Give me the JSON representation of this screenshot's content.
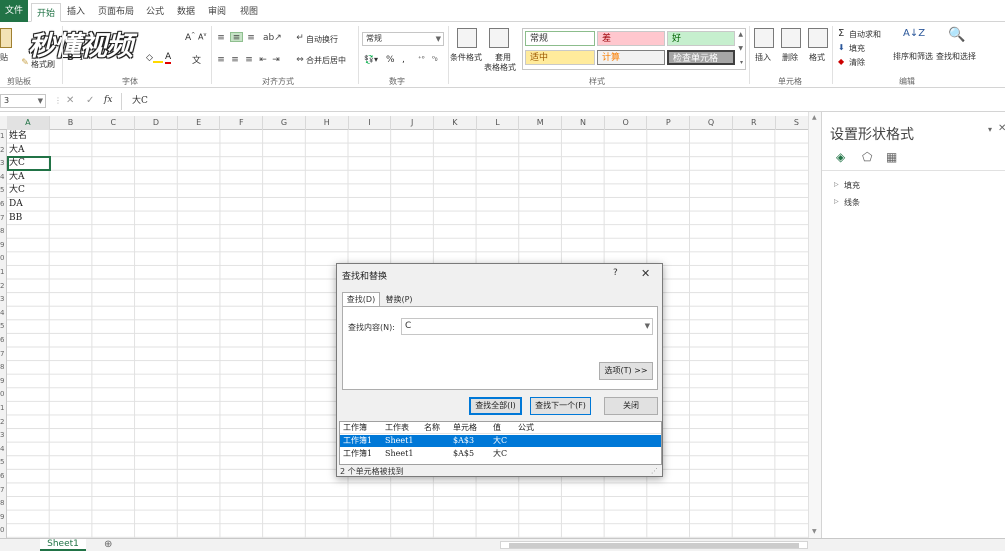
{
  "ribbon_tabs": {
    "file": "文件",
    "home": "开始",
    "insert": "插入",
    "layout": "页面布局",
    "formula": "公式",
    "data": "数据",
    "review": "审阅",
    "view": "视图"
  },
  "watermark": "秒懂视频",
  "clipboard": {
    "paste": "贴",
    "format_painter": "格式刷",
    "label": "剪贴板"
  },
  "font": {
    "label": "字体"
  },
  "align": {
    "wrap": "自动换行",
    "merge": "合并后居中",
    "label": "对齐方式"
  },
  "number": {
    "format": "常规",
    "label": "数字"
  },
  "styles": {
    "conditional": "条件格式",
    "table_fmt_1": "套用",
    "table_fmt_2": "表格格式",
    "normal": "常规",
    "bad": "差",
    "good": "好",
    "neutral": "适中",
    "calc": "计算",
    "check": "检查单元格",
    "label": "样式"
  },
  "cells": {
    "insert": "插入",
    "delete": "删除",
    "format": "格式",
    "label": "单元格"
  },
  "editing": {
    "autosum": "自动求和",
    "fill": "填充",
    "clear": "清除",
    "sort": "排序和筛选",
    "find": "查找和选择",
    "label": "编辑"
  },
  "formula_bar": {
    "namebox": "3",
    "fx": "fx",
    "value": "大C"
  },
  "grid": {
    "columns": [
      "A",
      "B",
      "C",
      "D",
      "E",
      "F",
      "G",
      "H",
      "I",
      "J",
      "K",
      "L",
      "M",
      "N",
      "O",
      "P",
      "Q",
      "R",
      "S"
    ],
    "rows": [
      "1",
      "2",
      "3",
      "4",
      "5",
      "6",
      "7",
      "8",
      "9",
      "0",
      "1",
      "2",
      "3",
      "4",
      "5",
      "6",
      "7",
      "8",
      "9",
      "0",
      "1",
      "2",
      "3",
      "4",
      "5",
      "6",
      "7",
      "8",
      "9",
      "0"
    ],
    "cells": [
      "姓名",
      "大A",
      "大C",
      "大A",
      "大C",
      "DA",
      "BB"
    ]
  },
  "pane": {
    "title": "设置形状格式",
    "fill": "填充",
    "line": "线条"
  },
  "sheet_tab": "Sheet1",
  "dialog": {
    "title": "查找和替换",
    "help": "?",
    "tab_find": "查找(D)",
    "tab_replace": "替换(P)",
    "find_label": "查找内容(N):",
    "find_value": "C",
    "options_btn": "选项(T) >>",
    "find_all_btn": "查找全部(I)",
    "find_next_btn": "查找下一个(F)",
    "close_btn": "关闭",
    "result_headers": [
      "工作簿",
      "工作表",
      "名称",
      "单元格",
      "值",
      "公式"
    ],
    "results": [
      {
        "book": "工作簿1",
        "sheet": "Sheet1",
        "name": "",
        "cell": "$A$3",
        "value": "大C",
        "formula": ""
      },
      {
        "book": "工作簿1",
        "sheet": "Sheet1",
        "name": "",
        "cell": "$A$5",
        "value": "大C",
        "formula": ""
      }
    ],
    "status": "2 个单元格被找到"
  }
}
